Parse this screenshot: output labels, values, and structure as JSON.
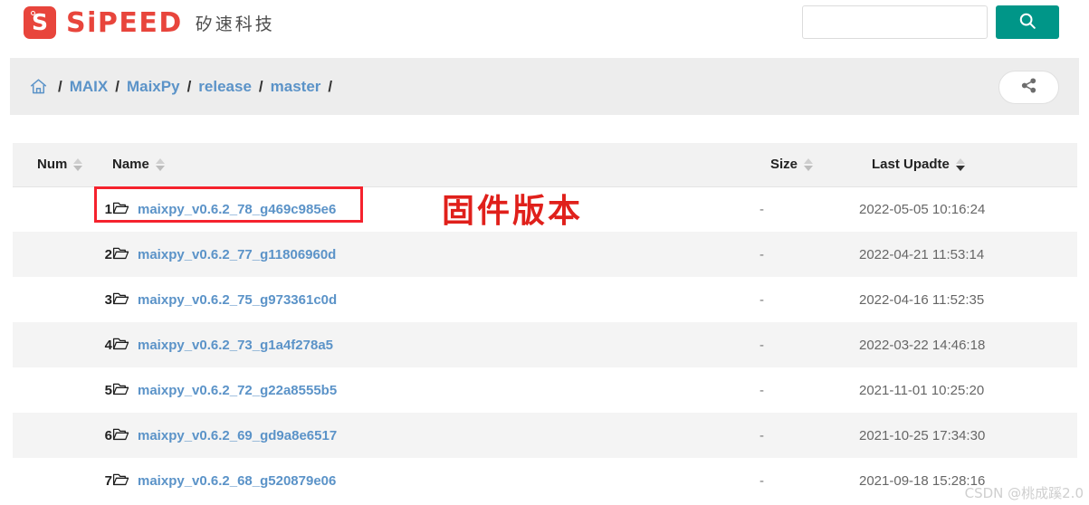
{
  "header": {
    "logo_letter": "S",
    "logo_word": "SiPEED",
    "logo_cn": "矽速科技",
    "search": {
      "value": "",
      "placeholder": "",
      "button_icon": "search-icon"
    }
  },
  "breadcrumb": {
    "home_icon": "home-icon",
    "separator": "/",
    "items": [
      {
        "label": "MAIX"
      },
      {
        "label": "MaixPy"
      },
      {
        "label": "release"
      },
      {
        "label": "master"
      }
    ],
    "share_icon": "share-icon"
  },
  "table": {
    "columns": [
      {
        "key": "num",
        "label": "Num",
        "sort": "none"
      },
      {
        "key": "name",
        "label": "Name",
        "sort": "none"
      },
      {
        "key": "size",
        "label": "Size",
        "sort": "none"
      },
      {
        "key": "date",
        "label": "Last Upadte",
        "sort": "desc"
      }
    ],
    "rows": [
      {
        "num": "1",
        "icon": "folder-icon",
        "name": "maixpy_v0.6.2_78_g469c985e6",
        "size": "-",
        "date": "2022-05-05 10:16:24"
      },
      {
        "num": "2",
        "icon": "folder-icon",
        "name": "maixpy_v0.6.2_77_g11806960d",
        "size": "-",
        "date": "2022-04-21 11:53:14"
      },
      {
        "num": "3",
        "icon": "folder-icon",
        "name": "maixpy_v0.6.2_75_g973361c0d",
        "size": "-",
        "date": "2022-04-16 11:52:35"
      },
      {
        "num": "4",
        "icon": "folder-icon",
        "name": "maixpy_v0.6.2_73_g1a4f278a5",
        "size": "-",
        "date": "2022-03-22 14:46:18"
      },
      {
        "num": "5",
        "icon": "folder-icon",
        "name": "maixpy_v0.6.2_72_g22a8555b5",
        "size": "-",
        "date": "2021-11-01 10:25:20"
      },
      {
        "num": "6",
        "icon": "folder-icon",
        "name": "maixpy_v0.6.2_69_gd9a8e6517",
        "size": "-",
        "date": "2021-10-25 17:34:30"
      },
      {
        "num": "7",
        "icon": "folder-icon",
        "name": "maixpy_v0.6.2_68_g520879e06",
        "size": "-",
        "date": "2021-09-18 15:28:16"
      }
    ]
  },
  "annotations": {
    "highlight_label": "固件版本",
    "watermark": "CSDN @桃成蹊2.0"
  },
  "colors": {
    "brand_red": "#e8453c",
    "search_teal": "#009688",
    "link_blue": "#5b93c8",
    "annotation_red": "#f5222d"
  }
}
